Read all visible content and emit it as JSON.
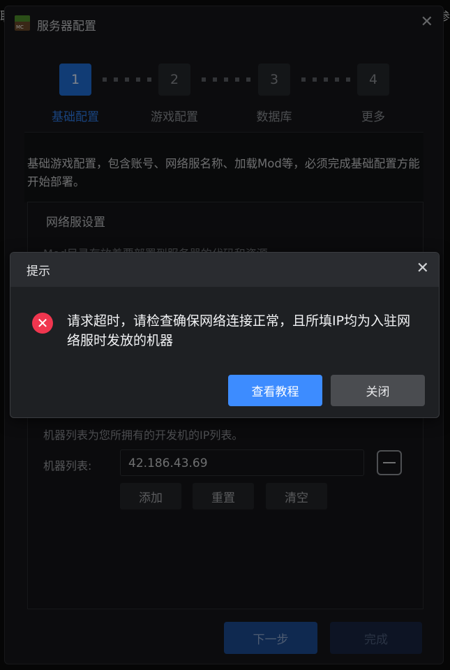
{
  "window": {
    "title": "服务器配置",
    "app_icon_text": "MC",
    "close_glyph": "✕"
  },
  "background_edges": {
    "left_char": "联",
    "right_char": "参"
  },
  "steps": [
    {
      "number": "1",
      "label": "基础配置",
      "active": true
    },
    {
      "number": "2",
      "label": "游戏配置",
      "active": false
    },
    {
      "number": "3",
      "label": "数据库",
      "active": false
    },
    {
      "number": "4",
      "label": "更多",
      "active": false
    }
  ],
  "description": "基础游戏配置，包含账号、网络服名称、加载Mod等，必须完成基础配置方能开始部署。",
  "network_settings": {
    "title": "网络服设置",
    "partial_hint": "Mod目录存放着要部署到服务器的代码和资源",
    "machine_hint": "机器列表为您所拥有的开发机的IP列表。",
    "machine_label": "机器列表:",
    "machine_ip": "42.186.43.69",
    "add_label": "添加",
    "reset_label": "重置",
    "clear_label": "清空"
  },
  "footer": {
    "next_label": "下一步",
    "finish_label": "完成"
  },
  "dialog": {
    "title": "提示",
    "close_glyph": "✕",
    "icon_glyph": "✕",
    "message": "请求超时，请检查确保网络连接正常，且所填IP均为入驻网络服时发放的机器",
    "tutorial_label": "查看教程",
    "close_label": "关闭"
  },
  "colors": {
    "accent": "#3d8cff",
    "error": "#f0364f",
    "active_step": "#1f6ed6"
  }
}
